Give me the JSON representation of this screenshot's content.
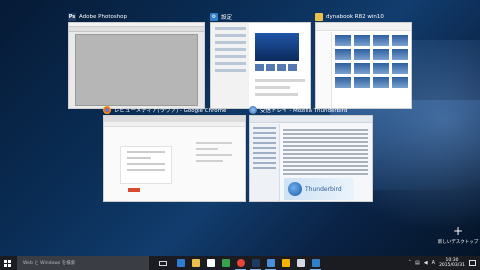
{
  "windows": {
    "photoshop": {
      "title": "Adobe Photoshop",
      "icon": "photoshop-icon",
      "icon_label": "Ps",
      "accent": "#1f3a60"
    },
    "settings": {
      "title": "設定",
      "icon": "gear-icon",
      "accent": "#2f7fc9"
    },
    "explorer": {
      "title": "dynabook R82 win10",
      "icon": "folder-icon",
      "accent": "#e8c04a"
    },
    "chrome": {
      "title": "レビューメディア(ラヴァ) - Google Chrome",
      "icon": "chrome-icon"
    },
    "thunderbird": {
      "title": "受信トレイ - Mozilla Thunderbird",
      "icon": "thunderbird-icon",
      "brand": "Thunderbird"
    }
  },
  "new_desktop": {
    "label": "新しいデスクトップ"
  },
  "taskbar": {
    "search_placeholder": "Web と Windows を検索",
    "pinned_apps": [
      {
        "name": "edge-icon",
        "color": "#2d7dd2"
      },
      {
        "name": "folder-icon",
        "color": "#e8c04a"
      },
      {
        "name": "store-icon",
        "color": "#ffffff"
      },
      {
        "name": "green-app-icon",
        "color": "#3ba24c"
      },
      {
        "name": "chrome-icon",
        "color": "#e5453a"
      },
      {
        "name": "photoshop-icon",
        "color": "#1f3a60"
      },
      {
        "name": "thunderbird-icon",
        "color": "#4a90d9"
      },
      {
        "name": "drive-icon",
        "color": "#f4b400"
      },
      {
        "name": "app-icon",
        "color": "#cfd8e3"
      },
      {
        "name": "settings-icon",
        "color": "#2f7fc9"
      }
    ],
    "tray_lang": "A",
    "clock_time": "10:30",
    "clock_date": "2015/03/31"
  }
}
